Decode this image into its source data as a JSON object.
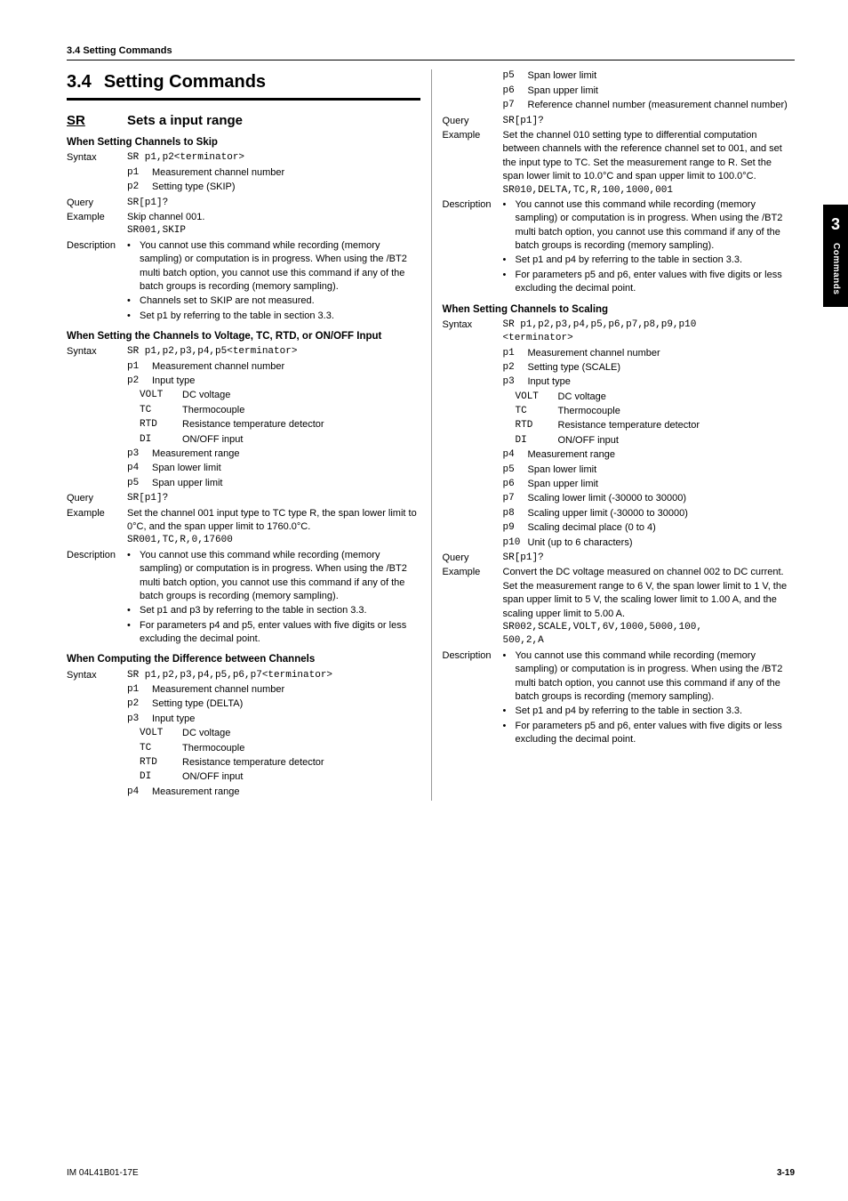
{
  "header": {
    "breadcrumb": "3.4  Setting Commands"
  },
  "section": {
    "num": "3.4",
    "title": "Setting Commands"
  },
  "cmd": {
    "code": "SR",
    "title": "Sets a input range"
  },
  "skip": {
    "heading": "When Setting Channels to Skip",
    "syntax_label": "Syntax",
    "syntax_value": "SR p1,p2<terminator>",
    "p1_code": "p1",
    "p1_desc": "Measurement channel number",
    "p2_code": "p2",
    "p2_desc": "Setting type (SKIP)",
    "query_label": "Query",
    "query_value": "SR[p1]?",
    "example_label": "Example",
    "example_text": "Skip channel 001.",
    "example_code": "SR001,SKIP",
    "desc_label": "Description",
    "b1": "You cannot use this command while recording (memory sampling) or computation is in progress. When using the /BT2 multi batch option, you cannot use this command if any of the batch groups is recording (memory sampling).",
    "b2": "Channels set to SKIP are not measured.",
    "b3": "Set p1 by referring to the table in section 3.3."
  },
  "volt": {
    "heading": "When Setting the Channels to Voltage, TC, RTD, or ON/OFF Input",
    "syntax_label": "Syntax",
    "syntax_value": "SR p1,p2,p3,p4,p5<terminator>",
    "p1_code": "p1",
    "p1_desc": "Measurement channel number",
    "p2_code": "p2",
    "p2_desc": "Input type",
    "t1c": "VOLT",
    "t1d": "DC voltage",
    "t2c": "TC",
    "t2d": "Thermocouple",
    "t3c": "RTD",
    "t3d": "Resistance temperature detector",
    "t4c": "DI",
    "t4d": "ON/OFF input",
    "p3_code": "p3",
    "p3_desc": "Measurement range",
    "p4_code": "p4",
    "p4_desc": "Span lower limit",
    "p5_code": "p5",
    "p5_desc": "Span upper limit",
    "query_label": "Query",
    "query_value": "SR[p1]?",
    "example_label": "Example",
    "example_text": "Set the channel 001 input type to TC type R, the span lower limit to 0°C, and the span upper limit to 1760.0°C.",
    "example_code": "SR001,TC,R,0,17600",
    "desc_label": "Description",
    "b1": "You cannot use this command while recording (memory sampling) or computation is in progress. When using the /BT2 multi batch option, you cannot use this command if any of the batch groups is recording (memory sampling).",
    "b2": "Set p1 and p3 by referring to the table in section 3.3.",
    "b3": "For parameters p4 and p5, enter values with five digits or less excluding the decimal point."
  },
  "diff": {
    "heading": "When Computing the Difference between Channels",
    "syntax_label": "Syntax",
    "syntax_value": "SR p1,p2,p3,p4,p5,p6,p7<terminator>",
    "p1_code": "p1",
    "p1_desc": "Measurement channel number",
    "p2_code": "p2",
    "p2_desc": "Setting type (DELTA)",
    "p3_code": "p3",
    "p3_desc": "Input type",
    "t1c": "VOLT",
    "t1d": "DC voltage",
    "t2c": "TC",
    "t2d": "Thermocouple",
    "t3c": "RTD",
    "t3d": "Resistance temperature detector",
    "t4c": "DI",
    "t4d": "ON/OFF input",
    "p4_code": "p4",
    "p4_desc": "Measurement range",
    "p5_code": "p5",
    "p5_desc": "Span lower limit",
    "p6_code": "p6",
    "p6_desc": "Span upper limit",
    "p7_code": "p7",
    "p7_desc": "Reference channel number (measurement channel number)",
    "query_label": "Query",
    "query_value": "SR[p1]?",
    "example_label": "Example",
    "example_text": "Set the channel 010 setting type to differential computation between channels with the reference channel set to 001, and set the input type to TC. Set the measurement range to R. Set the span lower limit to 10.0°C and span upper limit to 100.0°C.",
    "example_code": "SR010,DELTA,TC,R,100,1000,001",
    "desc_label": "Description",
    "b1": "You cannot use this command while recording (memory sampling) or computation is in progress. When using the /BT2 multi batch option, you cannot use this command if any of the batch groups is recording (memory sampling).",
    "b2": "Set p1 and p4 by referring to the table in section 3.3.",
    "b3": "For parameters p5 and p6, enter values with five digits or less excluding the decimal point."
  },
  "scale": {
    "heading": "When Setting Channels to Scaling",
    "syntax_label": "Syntax",
    "syntax_line1": "SR p1,p2,p3,p4,p5,p6,p7,p8,p9,p10",
    "syntax_line2": "<terminator>",
    "p1_code": "p1",
    "p1_desc": "Measurement channel number",
    "p2_code": "p2",
    "p2_desc": "Setting type (SCALE)",
    "p3_code": "p3",
    "p3_desc": "Input type",
    "t1c": "VOLT",
    "t1d": "DC voltage",
    "t2c": "TC",
    "t2d": "Thermocouple",
    "t3c": "RTD",
    "t3d": "Resistance temperature detector",
    "t4c": "DI",
    "t4d": "ON/OFF input",
    "p4_code": "p4",
    "p4_desc": "Measurement range",
    "p5_code": "p5",
    "p5_desc": "Span lower limit",
    "p6_code": "p6",
    "p6_desc": "Span upper limit",
    "p7_code": "p7",
    "p7_desc": "Scaling lower limit (-30000 to 30000)",
    "p8_code": "p8",
    "p8_desc": "Scaling upper limit (-30000 to 30000)",
    "p9_code": "p9",
    "p9_desc": "Scaling decimal place (0 to 4)",
    "p10_code": "p10",
    "p10_desc": "Unit (up to 6 characters)",
    "query_label": "Query",
    "query_value": "SR[p1]?",
    "example_label": "Example",
    "example_text": "Convert the DC voltage measured on channel 002 to DC current. Set the measurement range to 6 V, the span lower limit to 1 V, the span upper limit to 5 V, the scaling lower limit to 1.00 A, and the scaling upper limit to 5.00 A.",
    "example_code1": "SR002,SCALE,VOLT,6V,1000,5000,100,",
    "example_code2": "500,2,A",
    "desc_label": "Description",
    "b1": "You cannot use this command while recording (memory sampling) or computation is in progress. When using the /BT2 multi batch option, you cannot use this command if any of the batch groups is recording (memory sampling).",
    "b2": "Set p1 and p4 by referring to the table in section 3.3.",
    "b3": "For parameters p5 and p6, enter values with five digits or less excluding the decimal point."
  },
  "sidetab": {
    "num": "3",
    "label": "Commands"
  },
  "footer": {
    "left": "IM 04L41B01-17E",
    "right": "3-19"
  }
}
